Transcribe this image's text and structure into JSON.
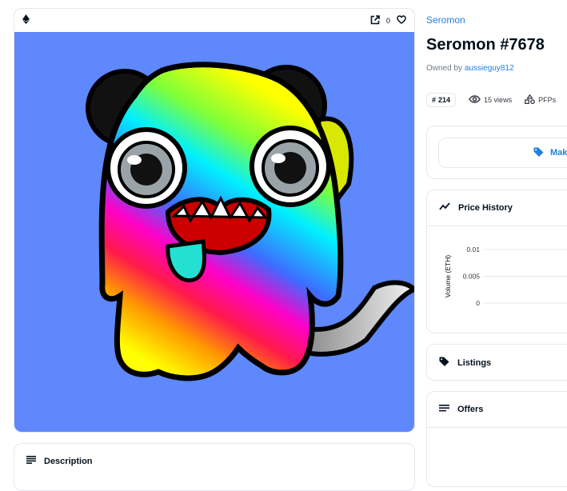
{
  "collection_name": "Seromon",
  "item": {
    "title": "Seromon #7678",
    "owned_by_label": "Owned by",
    "owner": "aussieguy812"
  },
  "image_panel": {
    "chain_icon": "ethereum-icon",
    "favorites_count": "0",
    "background_color": "#5e88fb"
  },
  "stats": {
    "rank": "214",
    "views": "15 views",
    "category": "PFPs"
  },
  "actions": {
    "make_offer": "Make offer"
  },
  "panels": {
    "description": "Description",
    "price_history": "Price History",
    "listings": "Listings",
    "offers": "Offers"
  },
  "chart_data": {
    "type": "line",
    "ylabel": "Volume (ETH)",
    "yticks": [
      "0.01",
      "0.005",
      "0"
    ],
    "ylim": [
      0,
      0.01
    ],
    "series": [],
    "grid": true
  },
  "colors": {
    "accent": "#2081e2",
    "text": "#04111d",
    "muted": "#707a83",
    "border": "#e5e8eb"
  }
}
